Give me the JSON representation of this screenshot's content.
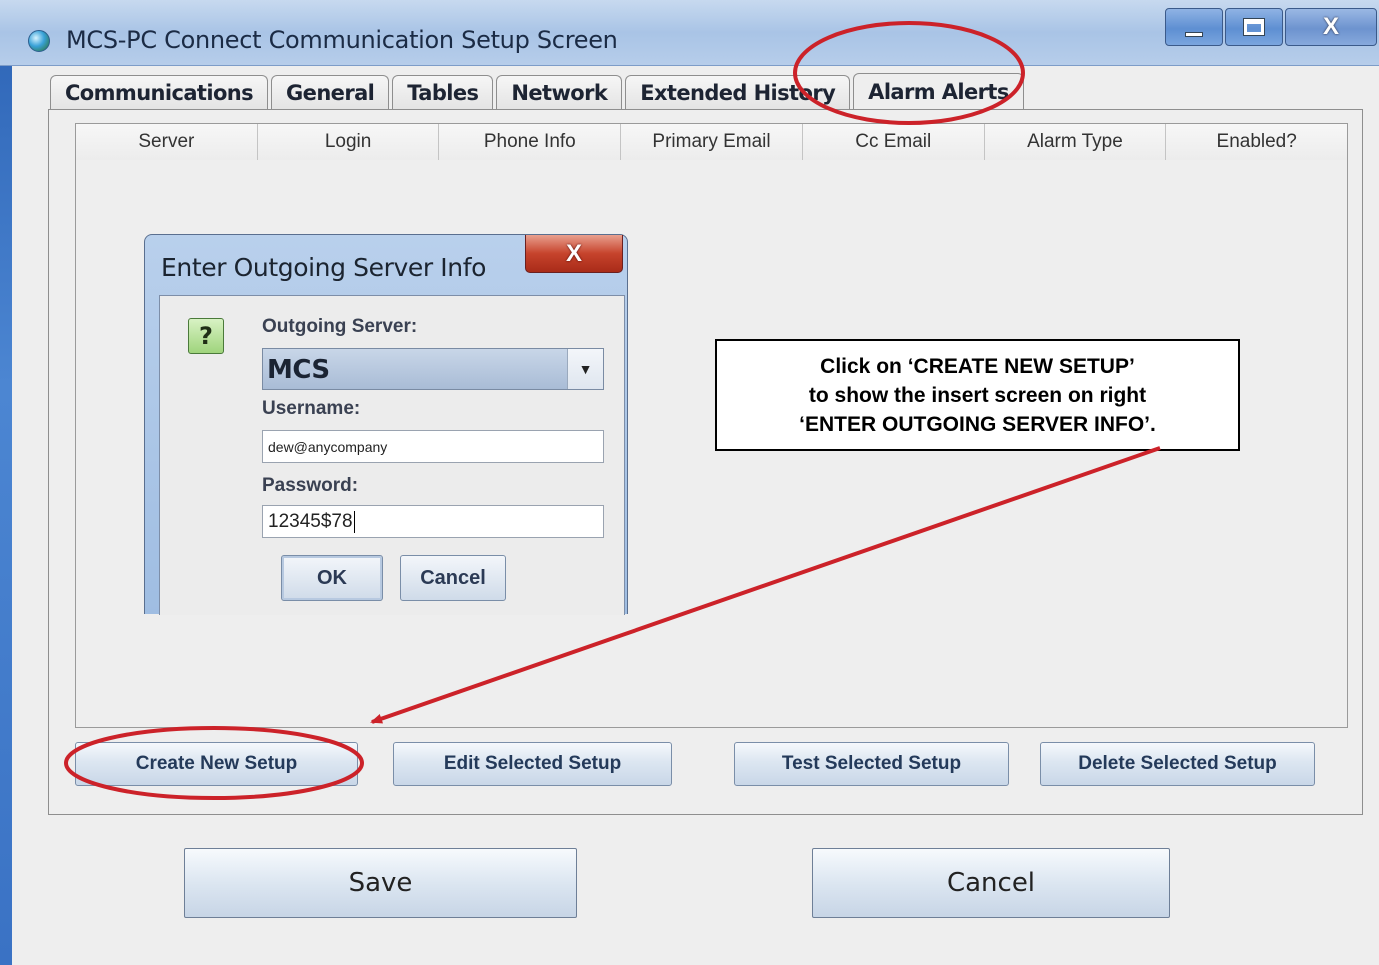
{
  "window": {
    "title": "MCS-PC Connect Communication Setup Screen",
    "close_glyph": "X"
  },
  "tabs": [
    {
      "label": "Communications"
    },
    {
      "label": "General"
    },
    {
      "label": "Tables"
    },
    {
      "label": "Network"
    },
    {
      "label": "Extended History"
    },
    {
      "label": "Alarm Alerts",
      "active": true
    }
  ],
  "table": {
    "columns": [
      "Server",
      "Login",
      "Phone Info",
      "Primary Email",
      "Cc Email",
      "Alarm Type",
      "Enabled?"
    ],
    "rows": []
  },
  "actions": {
    "create": "Create New Setup",
    "edit": "Edit Selected Setup",
    "test": "Test Selected Setup",
    "delete": "Delete Selected Setup"
  },
  "footer": {
    "save": "Save",
    "cancel": "Cancel"
  },
  "dialog": {
    "title": "Enter Outgoing Server Info",
    "close_glyph": "X",
    "icon_glyph": "?",
    "server_label": "Outgoing Server:",
    "server_value": "MCS",
    "username_label": "Username:",
    "username_value": "dew@anycompany",
    "password_label": "Password:",
    "password_value": "12345$78",
    "ok": "OK",
    "cancel": "Cancel"
  },
  "annotation": {
    "line1": "Click on ‘CREATE NEW SETUP’",
    "line2": "to show the insert screen on right",
    "line3": "‘ENTER OUTGOING SERVER INFO’.",
    "color": "#cc2229"
  }
}
